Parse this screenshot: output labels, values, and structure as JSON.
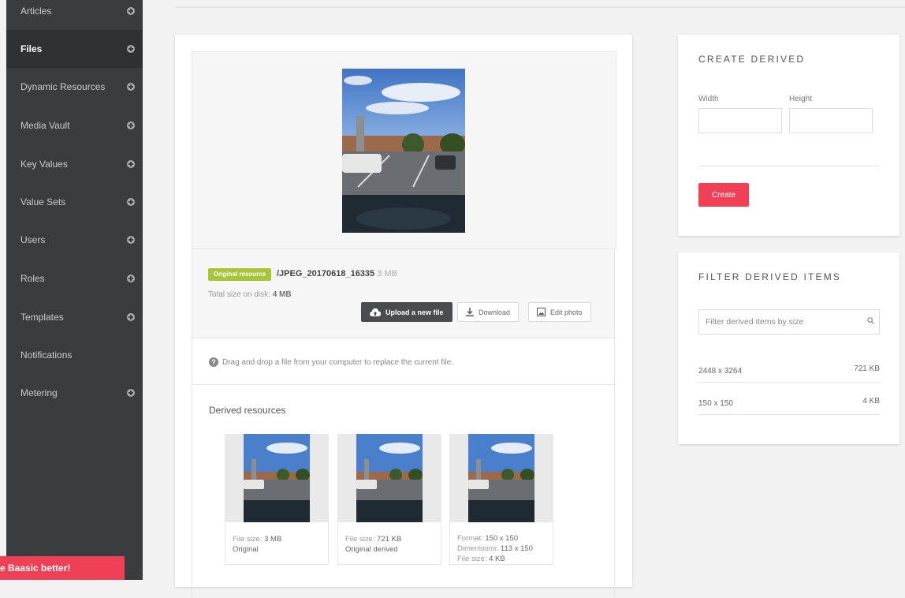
{
  "sidebar": {
    "items": [
      {
        "label": "Articles",
        "has_plus": true,
        "active": false
      },
      {
        "label": "Files",
        "has_plus": true,
        "active": true
      },
      {
        "label": "Dynamic Resources",
        "has_plus": true,
        "active": false
      },
      {
        "label": "Media Vault",
        "has_plus": true,
        "active": false
      },
      {
        "label": "Key Values",
        "has_plus": true,
        "active": false
      },
      {
        "label": "Value Sets",
        "has_plus": true,
        "active": false
      },
      {
        "label": "Users",
        "has_plus": true,
        "active": false
      },
      {
        "label": "Roles",
        "has_plus": true,
        "active": false
      },
      {
        "label": "Templates",
        "has_plus": true,
        "active": false
      },
      {
        "label": "Notifications",
        "has_plus": false,
        "active": false
      },
      {
        "label": "Metering",
        "has_plus": true,
        "active": false
      }
    ],
    "promo_text": "e Baasic better!"
  },
  "file": {
    "badge": "Original resource",
    "name": "/JPEG_20170618_16335",
    "size": "3 MB",
    "total_label": "Total size on disk:",
    "total_value": "4 MB"
  },
  "actions": {
    "upload": "Upload a new file",
    "download": "Download",
    "edit": "Edit photo"
  },
  "drop_hint": "Drag and drop a file from your computer to replace the current file.",
  "derived": {
    "title": "Derived resources",
    "items": [
      {
        "line1_label": "File size:",
        "line1_value": "3 MB",
        "line2": "Original"
      },
      {
        "line1_label": "File size:",
        "line1_value": "721 KB",
        "line2": "Original derived"
      },
      {
        "line1_label": "Format:",
        "line1_value": "150 x 150",
        "line2_label": "Dimensions:",
        "line2_value": "113 x 150",
        "line3_label": "File size:",
        "line3_value": "4 KB"
      }
    ]
  },
  "create_derived": {
    "title": "CREATE DERIVED",
    "width_label": "Width",
    "height_label": "Height",
    "button": "Create"
  },
  "filter": {
    "title": "FILTER DERIVED ITEMS",
    "placeholder": "Filter derived items by size",
    "rows": [
      {
        "dimensions": "2448 x 3264",
        "size": "721 KB"
      },
      {
        "dimensions": "150 x 150",
        "size": "4 KB"
      }
    ]
  },
  "colors": {
    "sidebar_bg": "#3a3d40",
    "accent_red": "#ef4055",
    "badge_green": "#a8c539"
  }
}
